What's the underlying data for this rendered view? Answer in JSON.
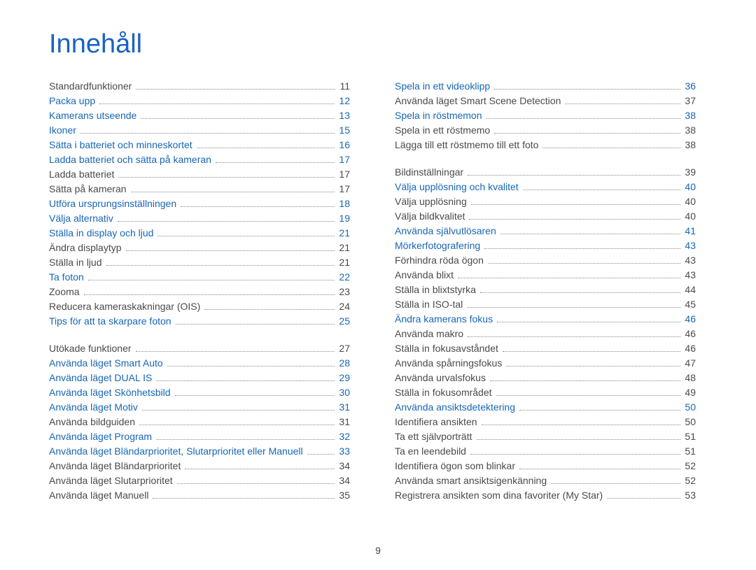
{
  "title": "Innehåll",
  "page_number": "9",
  "columns": [
    [
      {
        "label": "Standardfunktioner",
        "page": "11",
        "style": "plain",
        "section": true
      },
      {
        "label": "Packa upp",
        "page": "12",
        "style": "link"
      },
      {
        "label": "Kamerans utseende",
        "page": "13",
        "style": "link"
      },
      {
        "label": "Ikoner",
        "page": "15",
        "style": "link"
      },
      {
        "label": "Sätta i batteriet och minneskortet",
        "page": "16",
        "style": "link"
      },
      {
        "label": "Ladda batteriet och sätta på kameran",
        "page": "17",
        "style": "link"
      },
      {
        "label": "Ladda batteriet",
        "page": "17",
        "style": "plain"
      },
      {
        "label": "Sätta på kameran",
        "page": "17",
        "style": "plain"
      },
      {
        "label": "Utföra ursprungsinställningen",
        "page": "18",
        "style": "link"
      },
      {
        "label": "Välja alternativ",
        "page": "19",
        "style": "link"
      },
      {
        "label": "Ställa in display och ljud",
        "page": "21",
        "style": "link"
      },
      {
        "label": "Ändra displaytyp",
        "page": "21",
        "style": "plain"
      },
      {
        "label": "Ställa in ljud",
        "page": "21",
        "style": "plain"
      },
      {
        "label": "Ta foton",
        "page": "22",
        "style": "link"
      },
      {
        "label": "Zooma",
        "page": "23",
        "style": "plain"
      },
      {
        "label": "Reducera kameraskakningar (OIS)",
        "page": "24",
        "style": "plain"
      },
      {
        "label": "Tips för att ta skarpare foton",
        "page": "25",
        "style": "link"
      },
      {
        "label": "Utökade funktioner",
        "page": "27",
        "style": "plain",
        "section": true
      },
      {
        "label": "Använda läget Smart Auto",
        "page": "28",
        "style": "link"
      },
      {
        "label": "Använda läget DUAL IS",
        "page": "29",
        "style": "link"
      },
      {
        "label": "Använda läget Skönhetsbild",
        "page": "30",
        "style": "link"
      },
      {
        "label": "Använda läget Motiv",
        "page": "31",
        "style": "link"
      },
      {
        "label": "Använda bildguiden",
        "page": "31",
        "style": "plain"
      },
      {
        "label": "Använda läget Program",
        "page": "32",
        "style": "link"
      },
      {
        "label": "Använda läget Bländarprioritet, Slutarprioritet eller Manuell",
        "page": "33",
        "style": "link"
      },
      {
        "label": "Använda läget Bländarprioritet",
        "page": "34",
        "style": "plain"
      },
      {
        "label": "Använda läget Slutarprioritet",
        "page": "34",
        "style": "plain"
      },
      {
        "label": "Använda läget Manuell",
        "page": "35",
        "style": "plain"
      }
    ],
    [
      {
        "label": "Spela in ett videoklipp",
        "page": "36",
        "style": "link"
      },
      {
        "label": "Använda läget Smart Scene Detection",
        "page": "37",
        "style": "plain"
      },
      {
        "label": "Spela in röstmemon",
        "page": "38",
        "style": "link"
      },
      {
        "label": "Spela in ett röstmemo",
        "page": "38",
        "style": "plain"
      },
      {
        "label": "Lägga till ett röstmemo till ett foto",
        "page": "38",
        "style": "plain"
      },
      {
        "label": "Bildinställningar",
        "page": "39",
        "style": "plain",
        "section": true
      },
      {
        "label": "Välja upplösning och kvalitet",
        "page": "40",
        "style": "link"
      },
      {
        "label": "Välja upplösning",
        "page": "40",
        "style": "plain"
      },
      {
        "label": "Välja bildkvalitet",
        "page": "40",
        "style": "plain"
      },
      {
        "label": "Använda självutlösaren",
        "page": "41",
        "style": "link"
      },
      {
        "label": "Mörkerfotografering",
        "page": "43",
        "style": "link"
      },
      {
        "label": "Förhindra röda ögon",
        "page": "43",
        "style": "plain"
      },
      {
        "label": "Använda blixt",
        "page": "43",
        "style": "plain"
      },
      {
        "label": "Ställa in blixtstyrka",
        "page": "44",
        "style": "plain"
      },
      {
        "label": "Ställa in ISO-tal",
        "page": "45",
        "style": "plain"
      },
      {
        "label": "Ändra kamerans fokus",
        "page": "46",
        "style": "link"
      },
      {
        "label": "Använda makro",
        "page": "46",
        "style": "plain"
      },
      {
        "label": "Ställa in fokusavståndet",
        "page": "46",
        "style": "plain"
      },
      {
        "label": "Använda spårningsfokus",
        "page": "47",
        "style": "plain"
      },
      {
        "label": "Använda urvalsfokus",
        "page": "48",
        "style": "plain"
      },
      {
        "label": "Ställa in fokusområdet",
        "page": "49",
        "style": "plain"
      },
      {
        "label": "Använda ansiktsdetektering",
        "page": "50",
        "style": "link"
      },
      {
        "label": "Identifiera ansikten",
        "page": "50",
        "style": "plain"
      },
      {
        "label": "Ta ett självporträtt",
        "page": "51",
        "style": "plain"
      },
      {
        "label": "Ta en leendebild",
        "page": "51",
        "style": "plain"
      },
      {
        "label": "Identifiera ögon som blinkar",
        "page": "52",
        "style": "plain"
      },
      {
        "label": "Använda smart ansiktsigenkänning",
        "page": "52",
        "style": "plain"
      },
      {
        "label": "Registrera ansikten som dina favoriter (My Star)",
        "page": "53",
        "style": "plain"
      }
    ]
  ]
}
